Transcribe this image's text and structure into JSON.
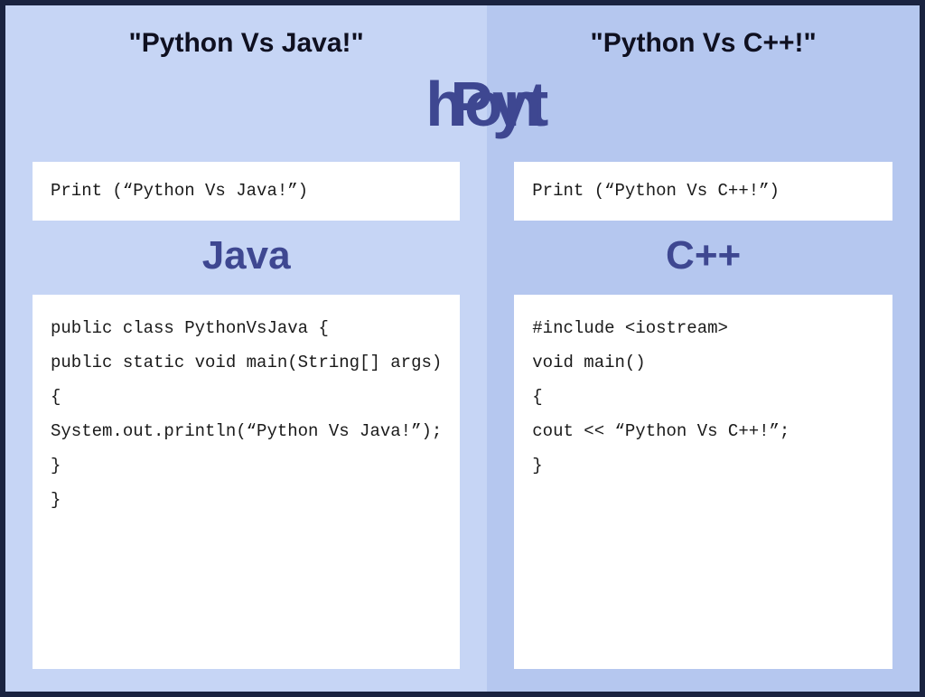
{
  "left": {
    "quote": "\"Python Vs Java!\"",
    "pythonLabelHalf": "Pyt",
    "pythonCode": "Print (“Python Vs Java!”)",
    "langLabel": "Java",
    "langCode": "public class PythonVsJava {\npublic static void main(String[] args)\n{\nSystem.out.println(“Python Vs Java!”);\n}\n}"
  },
  "right": {
    "quote": "\"Python Vs C++!\"",
    "pythonLabelHalf": "hon",
    "pythonCode": "Print (“Python Vs C++!”)",
    "langLabel": "C++",
    "langCode": "#include <iostream>\nvoid main()\n{\ncout << “Python Vs C++!”;\n}"
  }
}
